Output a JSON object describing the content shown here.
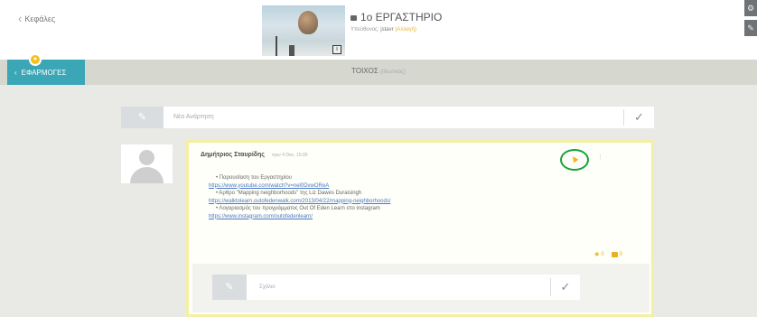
{
  "header": {
    "back_label": "Κεφάλες",
    "board_title": "1ο ΕΡΓΑΣΤΗΡΙΟ",
    "owner_prefix": "Υπεύθυνος:",
    "owner_name": "jstavr",
    "change_label": "(Αλλαγή)"
  },
  "toolbar": {
    "apps_label": "ΕΦΑΡΜΟΓΕΣ",
    "apps_badge_count": "",
    "wall_label": "ΤΟΙΧΟΣ",
    "wall_sublabel": "(Ιδιωτικός)"
  },
  "new_post": {
    "placeholder": "Νέα Ανάρτηση"
  },
  "post": {
    "author": "Δημήτριος Σταυρίδης",
    "timestamp": "πριν 4 Dec, 15:00",
    "lines": [
      {
        "text": "• Παρουσίαση του Εργαστηρίου",
        "is_link": false
      },
      {
        "text": "https://www.youtube.com/watch?v=nel0DvwOReA",
        "is_link": true
      },
      {
        "text": "• Άρθρο \"Mapping neighborhoods\" της Liz Dawes Duraisingh",
        "is_link": false
      },
      {
        "text": "https://walktolearn.outofedenwalk.com/2013/04/22/mapping-neighborhoods/",
        "is_link": true
      },
      {
        "text": "• Λογαριασμός του προγράμματος Out Of Eden Learn στο instagram",
        "is_link": false
      },
      {
        "text": "https://www.instagram.com/outofedenlearn/",
        "is_link": true
      }
    ],
    "comments_count": "0",
    "likes_count": "0"
  },
  "comment": {
    "placeholder": "Σχόλιο"
  },
  "colors": {
    "accent": "#3aa6b6",
    "badge": "#f4c21b",
    "pin": "#f1b418",
    "highlight_ring": "#17a23a",
    "post_border": "#f3f0a3",
    "link": "#4a78c2"
  },
  "icons": {
    "back": "chevron-left-icon",
    "pin": "pin-icon",
    "edit": "pencil-icon",
    "submit": "check-icon",
    "comment": "comment-icon",
    "like": "thumb-icon"
  }
}
